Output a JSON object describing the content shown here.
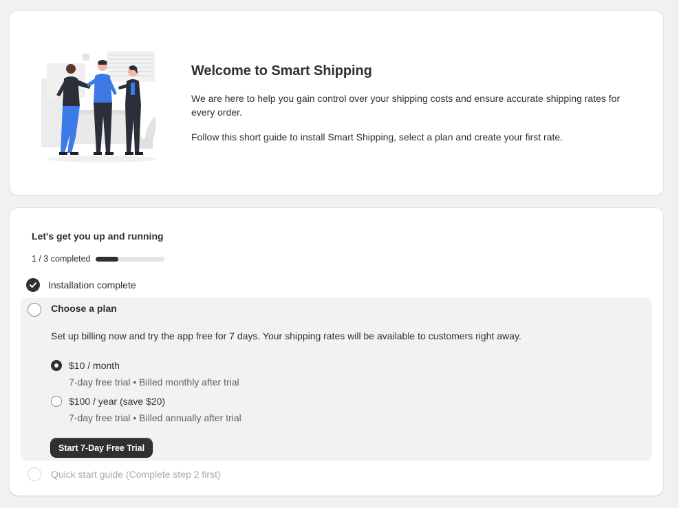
{
  "welcome": {
    "title": "Welcome to Smart Shipping",
    "intro": "We are here to help you gain control over your shipping costs and ensure accurate shipping rates for every order.",
    "guide": "Follow this short guide to install Smart Shipping, select a plan and create your first rate."
  },
  "setup": {
    "title": "Let's get you up and running",
    "progress_label": "1 / 3 completed",
    "progress_fraction": 0.33,
    "steps": [
      {
        "label": "Installation complete",
        "status": "complete"
      },
      {
        "label": "Choose a plan",
        "status": "active",
        "description": "Set up billing now and try the app free for 7 days. Your shipping rates will be available to customers right away.",
        "plans": [
          {
            "label": "$10 / month",
            "help": "7-day free trial • Billed monthly after trial",
            "selected": true
          },
          {
            "label": "$100 / year (save $20)",
            "help": "7-day free trial • Billed annually after trial",
            "selected": false
          }
        ],
        "button_label": "Start 7-Day Free Trial"
      },
      {
        "label": "Quick start guide (Complete step 2 first)",
        "status": "disabled"
      }
    ]
  },
  "icons": {
    "step_complete": "checkmark-circle-icon",
    "step_pending": "empty-circle-icon"
  },
  "colors": {
    "background": "#f1f1f1",
    "primary": "#303030",
    "accent_illustration": "#3d7ae8"
  }
}
